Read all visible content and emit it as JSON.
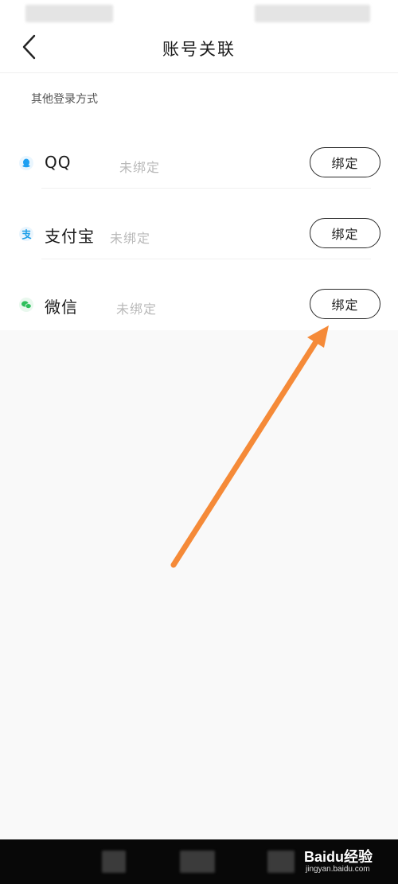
{
  "header": {
    "title": "账号关联"
  },
  "section": {
    "header": "其他登录方式",
    "items": [
      {
        "name": "QQ",
        "status": "未绑定",
        "button": "绑定",
        "icon": "qq-icon",
        "icon_color": "#1ea0f2"
      },
      {
        "name": "支付宝",
        "status": "未绑定",
        "button": "绑定",
        "icon": "alipay-icon",
        "icon_color": "#1e9fe8"
      },
      {
        "name": "微信",
        "status": "未绑定",
        "button": "绑定",
        "icon": "wechat-icon",
        "icon_color": "#2dbf5b"
      }
    ]
  },
  "annotation": {
    "arrow_color": "#f58a38"
  },
  "watermark": {
    "line1": "Baidu经验",
    "line2": "jingyan.baidu.com"
  }
}
